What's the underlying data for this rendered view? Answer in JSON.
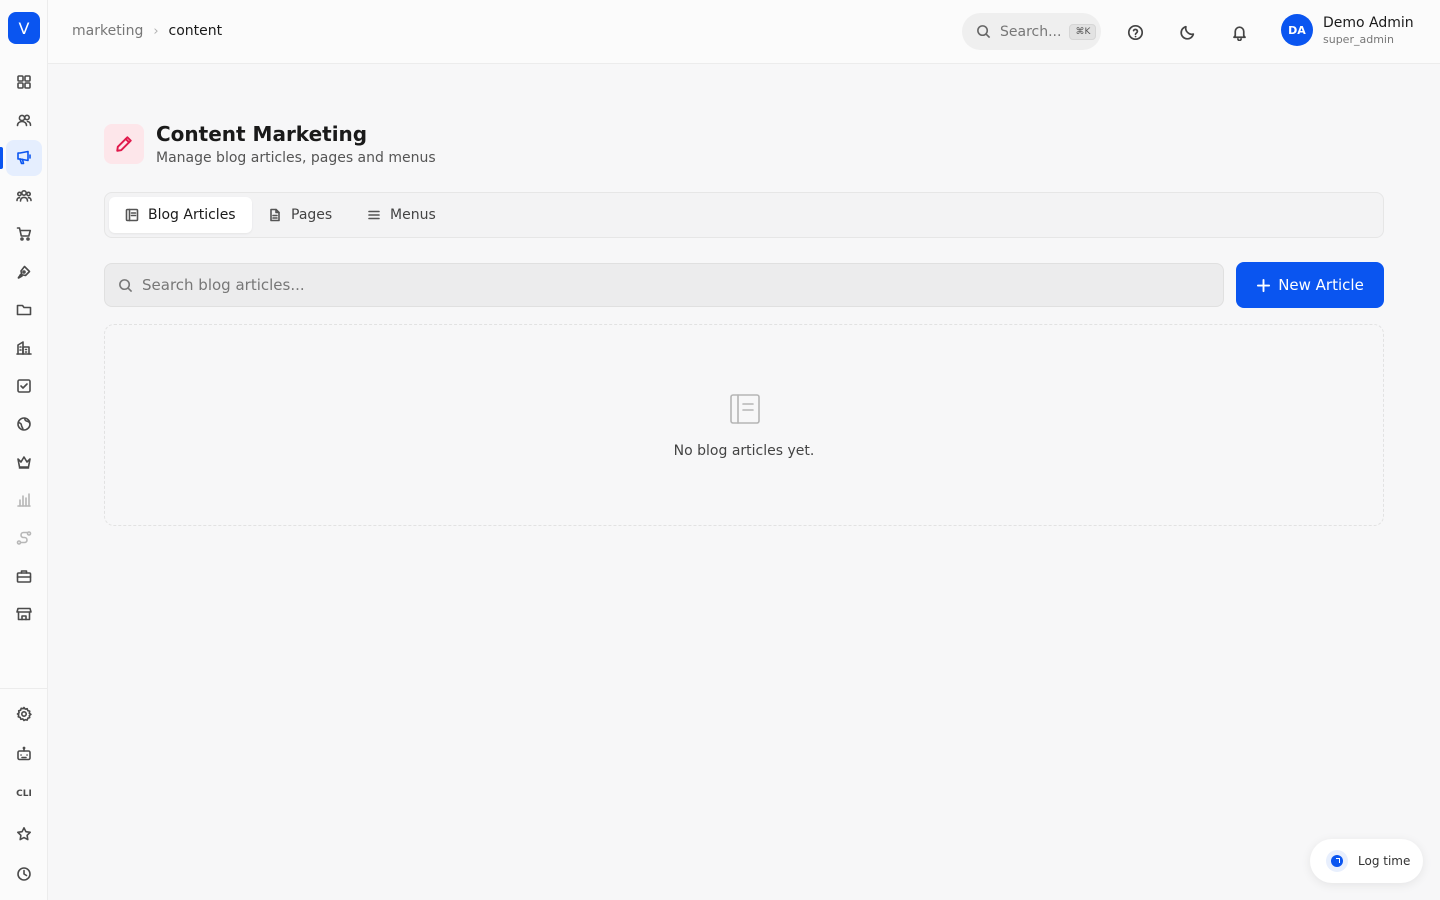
{
  "app": {
    "logo_letter": "V"
  },
  "sidebar": {
    "items": [
      {
        "icon": "dashboard-icon"
      },
      {
        "icon": "users-icon"
      },
      {
        "icon": "megaphone-icon",
        "active": true
      },
      {
        "icon": "team-icon"
      },
      {
        "icon": "cart-icon"
      },
      {
        "icon": "pen-tool-icon"
      },
      {
        "icon": "folder-icon"
      },
      {
        "icon": "building-icon"
      },
      {
        "icon": "check-square-icon"
      },
      {
        "icon": "globe-icon"
      },
      {
        "icon": "crown-icon"
      },
      {
        "icon": "bar-chart-icon"
      },
      {
        "icon": "route-icon"
      },
      {
        "icon": "briefcase-icon"
      },
      {
        "icon": "store-icon"
      }
    ],
    "bottom_items": [
      {
        "icon": "settings-icon"
      },
      {
        "icon": "bot-icon"
      },
      {
        "label": "CLI"
      },
      {
        "icon": "star-icon"
      },
      {
        "icon": "clock-icon"
      }
    ]
  },
  "topbar": {
    "breadcrumb": {
      "parent": "marketing",
      "current": "content"
    },
    "search": {
      "placeholder": "Search...",
      "shortcut": "⌘K"
    },
    "user": {
      "initials": "DA",
      "name": "Demo Admin",
      "role": "super_admin"
    }
  },
  "page": {
    "title": "Content Marketing",
    "subtitle": "Manage blog articles, pages and menus",
    "accent_color": "#e0194b"
  },
  "tabs": [
    {
      "label": "Blog Articles",
      "icon": "article-icon",
      "active": true
    },
    {
      "label": "Pages",
      "icon": "file-icon"
    },
    {
      "label": "Menus",
      "icon": "menu-icon"
    }
  ],
  "content": {
    "search_placeholder": "Search blog articles...",
    "new_button_label": "New Article",
    "empty_message": "No blog articles yet."
  },
  "log_time": {
    "label": "Log time"
  },
  "colors": {
    "primary": "#0a55f0"
  }
}
